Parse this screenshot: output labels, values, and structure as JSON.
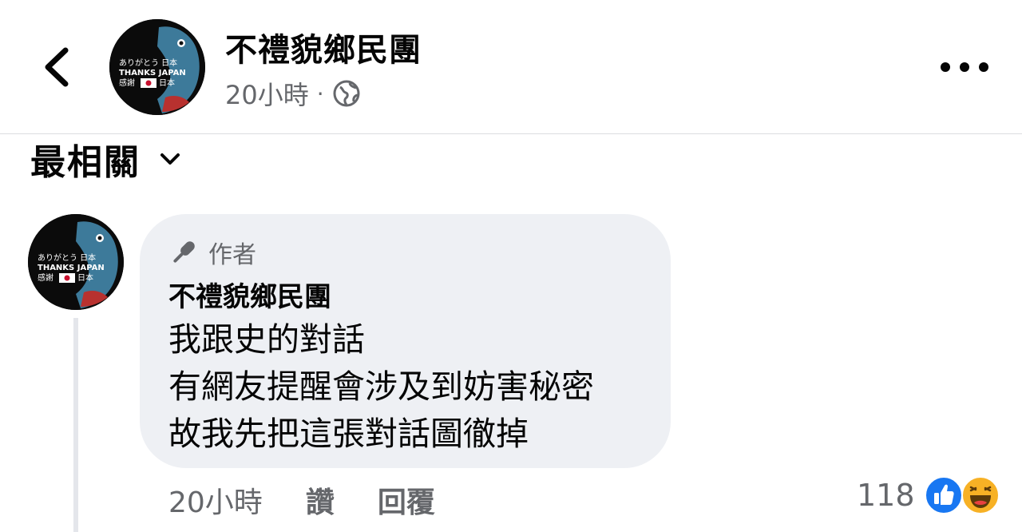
{
  "header": {
    "page_name": "不禮貌鄉民團",
    "timestamp": "20小時",
    "dot": "·",
    "avatar": {
      "line1": "ありがとう 日本",
      "line2": "THANKS JAPAN",
      "line3a": "感謝",
      "line3b": "日本"
    }
  },
  "sort": {
    "label": "最相關"
  },
  "comment": {
    "badge": "作者",
    "author": "不禮貌鄉民團",
    "lines": [
      "我跟史的對話",
      "有網友提醒會涉及到妨害秘密",
      "故我先把這張對話圖徹掉"
    ],
    "time": "20小時",
    "like_label": "讚",
    "reply_label": "回覆",
    "reaction_count": "118",
    "reactions": [
      "like-icon",
      "haha-icon"
    ]
  },
  "colors": {
    "secondary_text": "#65676b",
    "bubble_bg": "#eef0f4",
    "like_blue": "#1877f2",
    "haha_yellow": "#f7b125"
  }
}
